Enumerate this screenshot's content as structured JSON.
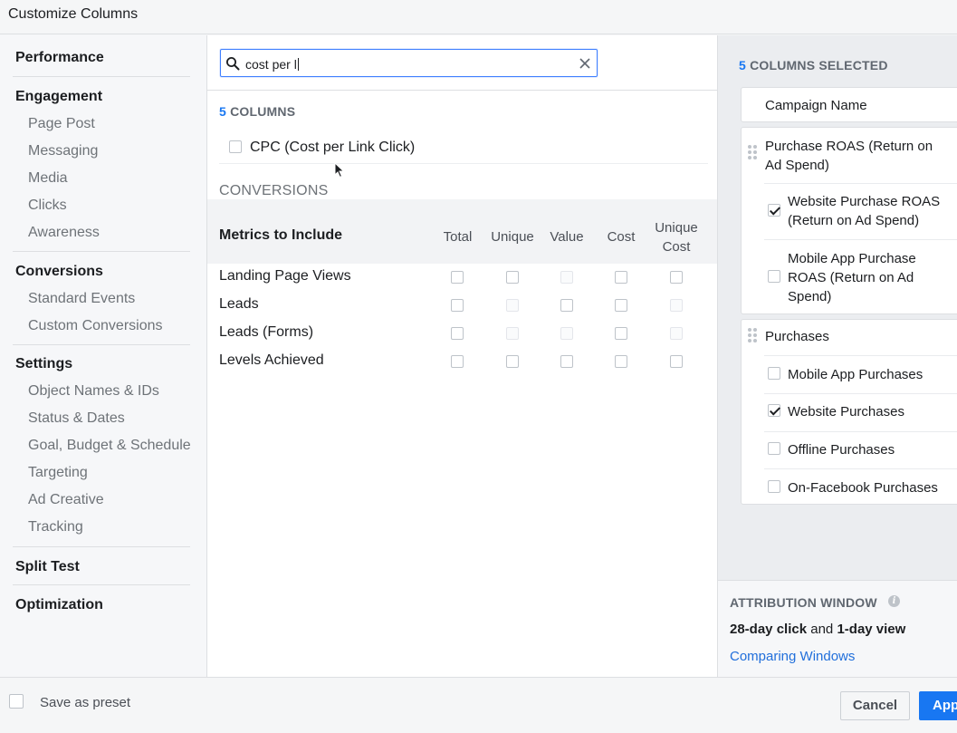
{
  "dialog": {
    "title": "Customize Columns"
  },
  "sidebar": {
    "sections": [
      {
        "label": "Performance",
        "items": []
      },
      {
        "label": "Engagement",
        "items": [
          "Page Post",
          "Messaging",
          "Media",
          "Clicks",
          "Awareness"
        ]
      },
      {
        "label": "Conversions",
        "items": [
          "Standard Events",
          "Custom Conversions"
        ]
      },
      {
        "label": "Settings",
        "items": [
          "Object Names & IDs",
          "Status & Dates",
          "Goal, Budget & Schedule",
          "Targeting",
          "Ad Creative",
          "Tracking"
        ]
      },
      {
        "label": "Split Test",
        "items": []
      },
      {
        "label": "Optimization",
        "items": []
      }
    ]
  },
  "search": {
    "value": "cost per l",
    "icon": "search-icon",
    "clear_icon": "close-icon"
  },
  "results": {
    "count": "5",
    "count_suffix": "COLUMNS",
    "cpc_label": "CPC (Cost per Link Click)",
    "section_title": "CONVERSIONS",
    "metrics_header": "Metrics to Include",
    "columns": [
      "Total",
      "Unique",
      "Value",
      "Cost",
      "Unique Cost"
    ],
    "rows": [
      {
        "label": "Landing Page Views",
        "enabled": [
          true,
          true,
          false,
          true,
          true
        ]
      },
      {
        "label": "Leads",
        "enabled": [
          true,
          false,
          true,
          true,
          false
        ]
      },
      {
        "label": "Leads (Forms)",
        "enabled": [
          true,
          false,
          false,
          true,
          false
        ]
      },
      {
        "label": "Levels Achieved",
        "enabled": [
          true,
          true,
          true,
          true,
          true
        ]
      }
    ]
  },
  "selected": {
    "count": "5",
    "count_suffix": "COLUMNS SELECTED",
    "campaign_name": "Campaign Name",
    "roas_group": {
      "title": "Purchase ROAS (Return on Ad Spend)",
      "items": [
        {
          "label": "Website Purchase ROAS (Return on Ad Spend)",
          "checked": true
        },
        {
          "label": "Mobile App Purchase ROAS (Return on Ad Spend)",
          "checked": false
        }
      ]
    },
    "purchases_group": {
      "title": "Purchases",
      "items": [
        {
          "label": "Mobile App Purchases",
          "checked": false
        },
        {
          "label": "Website Purchases",
          "checked": true
        },
        {
          "label": "Offline Purchases",
          "checked": false
        },
        {
          "label": "On-Facebook Purchases",
          "checked": false
        }
      ]
    }
  },
  "attribution": {
    "title": "ATTRIBUTION WINDOW",
    "click": "28-day click",
    "and": "and",
    "view": "1-day view",
    "link": "Comparing Windows"
  },
  "footer": {
    "save_preset": "Save as preset",
    "cancel": "Cancel",
    "apply": "Apply"
  },
  "colors": {
    "accent": "#1877f2",
    "link": "#216fdb"
  }
}
